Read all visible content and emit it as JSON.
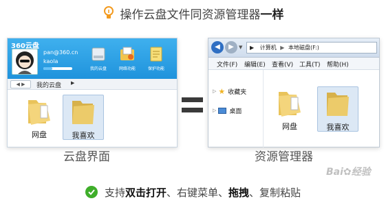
{
  "headline": {
    "prefix": "操作云盘文件同资源管理器",
    "emphasis": "一样"
  },
  "cloud": {
    "brand": "360云盘",
    "user": "pan@360.cn",
    "sub": "kaola",
    "quota_fraction": 0.3,
    "toolbar": [
      "我的云盘",
      "网络功能",
      "保护功能"
    ],
    "breadcrumb": "我的云盘",
    "folders": [
      {
        "label": "网盘"
      },
      {
        "label": "我喜欢"
      }
    ],
    "caption": "云盘界面"
  },
  "explorer": {
    "address": [
      "计算机",
      "本地磁盘(F:)"
    ],
    "menus": [
      "文件(F)",
      "编辑(E)",
      "查看(V)",
      "工具(T)",
      "帮助(H)"
    ],
    "sidebar": [
      "收藏夹",
      "桌面"
    ],
    "folders": [
      {
        "label": "网盘"
      },
      {
        "label": "我喜欢"
      }
    ],
    "caption": "资源管理器"
  },
  "footer": {
    "prefix": "支持 ",
    "bold1": "双击打开",
    "mid": "、右键菜单、",
    "bold2": "拖拽",
    "suffix": "、复制粘贴"
  },
  "watermark": "Baidu经验",
  "colors": {
    "header_blue": "#1f93dc",
    "check_green": "#3fae2a",
    "folder_yellow": "#e9c35a"
  }
}
